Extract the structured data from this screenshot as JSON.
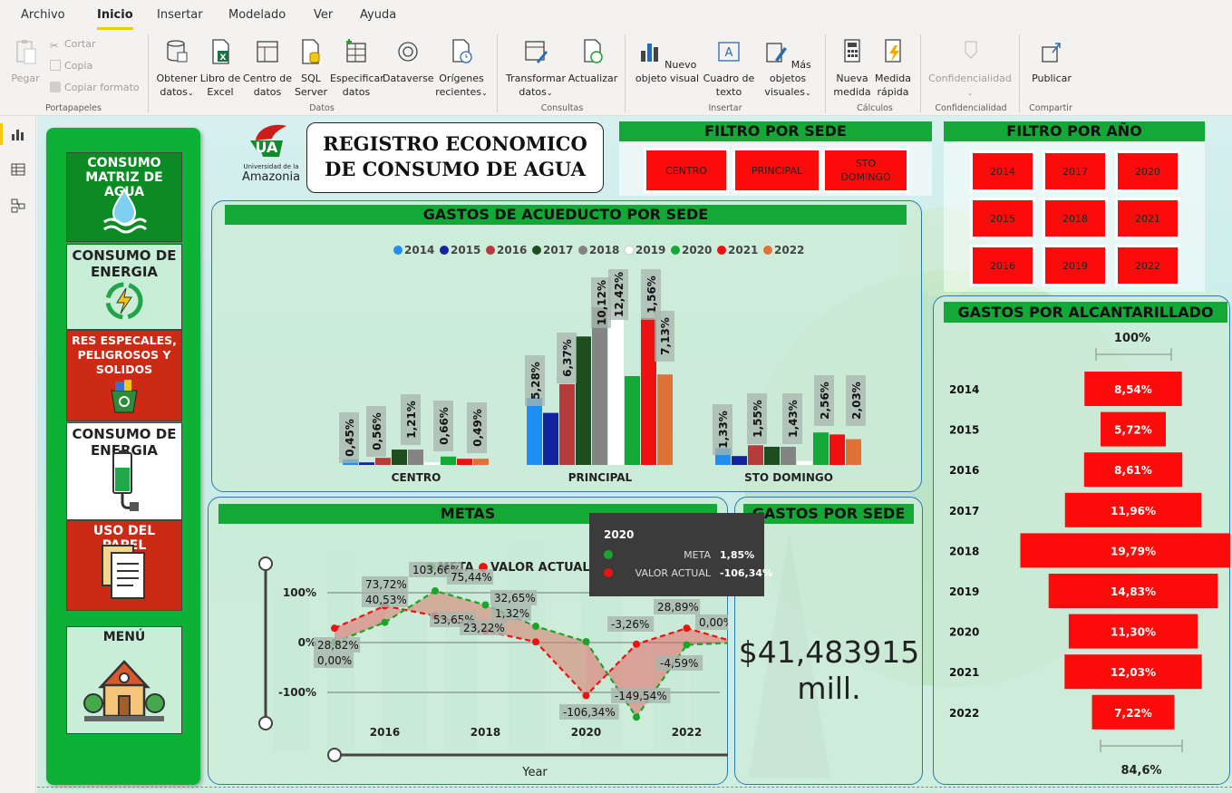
{
  "ribbon": {
    "tabs": [
      "Archivo",
      "Inicio",
      "Insertar",
      "Modelado",
      "Ver",
      "Ayuda"
    ],
    "active_tab": "Inicio",
    "clipboard": {
      "paste": "Pegar",
      "cut": "Cortar",
      "copy": "Copia",
      "format_painter": "Copiar formato",
      "group": "Portapapeles"
    },
    "data": {
      "get_data": "Obtener datos",
      "excel": "Libro de Excel",
      "datahub": "Centro de datos",
      "sql": "SQL Server",
      "enter_data": "Especificar datos",
      "dataverse": "Dataverse",
      "recent": "Orígenes recientes",
      "group": "Datos"
    },
    "queries": {
      "transform": "Transformar datos",
      "refresh": "Actualizar",
      "group": "Consultas"
    },
    "insert": {
      "new_visual": "Nuevo objeto visual",
      "text_box": "Cuadro de texto",
      "more_visuals": "Más objetos visuales",
      "group": "Insertar"
    },
    "calculations": {
      "new_measure": "Nueva medida",
      "quick_measure": "Medida rápida",
      "group": "Cálculos"
    },
    "sensitivity": {
      "label": "Confidencialidad",
      "group": "Confidencialidad"
    },
    "share": {
      "publish": "Publicar",
      "group": "Compartir"
    }
  },
  "report": {
    "logo_text_1": "Universidad de la",
    "logo_text_2": "Amazonia",
    "title_line1": "REGISTRO ECONOMICO",
    "title_line2": "DE CONSUMO DE AGUA",
    "nav": [
      {
        "label": "CONSUMO MATRIZ DE AGUA",
        "bg": "#0c8a24",
        "fg": "#ffffff",
        "icon": "water-icon"
      },
      {
        "label": "CONSUMO DE ENERGIA",
        "bg": "#c9eed8",
        "fg": "#222222",
        "icon": "recycle-energy-icon"
      },
      {
        "label": "RES ESPECALES, PELIGROSOS Y SOLIDOS",
        "bg": "#cc2a14",
        "fg": "#ffffff",
        "icon": "recycle-bin-icon"
      },
      {
        "label": "CONSUMO DE ENERGIA",
        "bg": "#ffffff",
        "fg": "#222222",
        "icon": "battery-plug-icon"
      },
      {
        "label": "USO DEL PAPEL",
        "bg": "#cc2a14",
        "fg": "#ffffff",
        "icon": "documents-icon"
      },
      {
        "label": "MENÚ",
        "bg": "#c9eed8",
        "fg": "#222222",
        "icon": "house-icon"
      }
    ],
    "filtro_sede": {
      "title": "FILTRO POR SEDE",
      "options": [
        "CENTRO",
        "PRINCIPAL",
        "STO DOMINGO"
      ]
    },
    "filtro_ano": {
      "title": "FILTRO POR AÑO",
      "options": [
        "2014",
        "2017",
        "2020",
        "2015",
        "2018",
        "2021",
        "2016",
        "2019",
        "2022"
      ]
    },
    "kpi": {
      "title": "GASTOS POR SEDE",
      "value_line1": "$41,483915",
      "value_line2": "mill."
    },
    "tooltip": {
      "title": "2020",
      "rows": [
        {
          "key": "META",
          "value": "1,85%",
          "color": "#1aa52a"
        },
        {
          "key": "VALOR ACTUAL",
          "value": "-106,34%",
          "color": "#ee1111"
        }
      ]
    }
  },
  "chart_data": [
    {
      "type": "bar",
      "title": "GASTOS DE ACUEDUCTO POR SEDE",
      "categories": [
        "CENTRO",
        "PRINCIPAL",
        "STO DOMINGO"
      ],
      "legend_position": "top-center",
      "series": [
        {
          "name": "2014",
          "color": "#1f8ef1",
          "values": [
            0.45,
            5.28,
            1.33
          ]
        },
        {
          "name": "2015",
          "color": "#12239e",
          "values": [
            0.2,
            4.1,
            0.7
          ]
        },
        {
          "name": "2016",
          "color": "#b83b3b",
          "values": [
            0.56,
            6.37,
            1.55
          ]
        },
        {
          "name": "2017",
          "color": "#1e4d1e",
          "values": [
            1.21,
            10.12,
            1.43
          ]
        },
        {
          "name": "2018",
          "color": "#848484",
          "values": [
            1.21,
            12.42,
            1.43
          ]
        },
        {
          "name": "2019",
          "color": "#ffffff",
          "values": [
            0.2,
            12.4,
            0.3
          ]
        },
        {
          "name": "2020",
          "color": "#14a837",
          "values": [
            0.66,
            7.0,
            2.56
          ]
        },
        {
          "name": "2021",
          "color": "#ee1111",
          "values": [
            0.49,
            11.56,
            2.4
          ]
        },
        {
          "name": "2022",
          "color": "#e07238",
          "values": [
            0.49,
            7.13,
            2.03
          ]
        }
      ],
      "labels": [
        {
          "cat": "CENTRO",
          "texts": [
            "0,45%",
            "0,56%",
            "1,21%",
            "0,66%",
            "0,49%"
          ]
        },
        {
          "cat": "PRINCIPAL",
          "texts": [
            "5,28%",
            "6,37%",
            "10,12%",
            "12,42%",
            "1,56%",
            "7,13%"
          ]
        },
        {
          "cat": "STO DOMINGO",
          "texts": [
            "1,33%",
            "1,55%",
            "1,43%",
            "2,56%",
            "2,03%"
          ]
        }
      ]
    },
    {
      "type": "line",
      "title": "METAS",
      "xlabel": "Year",
      "x": [
        2015,
        2016,
        2017,
        2018,
        2019,
        2020,
        2021,
        2022,
        2023
      ],
      "x_ticks": [
        "2016",
        "2018",
        "2020",
        "2022"
      ],
      "y_ticks": [
        "100%",
        "0%",
        "-100%"
      ],
      "ylim": [
        -150,
        150
      ],
      "series": [
        {
          "name": "META",
          "color": "#1aa52a",
          "values": [
            0.0,
            40.53,
            103.66,
            75.44,
            32.65,
            1.85,
            -149.54,
            -4.59,
            0.0
          ]
        },
        {
          "name": "VALOR ACTUAL",
          "color": "#ee1111",
          "values": [
            28.82,
            73.72,
            53.65,
            23.22,
            1.32,
            -106.34,
            -3.26,
            28.89,
            0.0
          ]
        }
      ],
      "data_labels": [
        "28,82%",
        "0,00%",
        "73,72%",
        "40,53%",
        "103,66%",
        "53,65%",
        "75,44%",
        "23,22%",
        "32,65%",
        "1,32%",
        "-106,34%",
        "-3,26%",
        "-149,54%",
        "28,89%",
        "-4,59%",
        "0,00%"
      ]
    },
    {
      "type": "bar",
      "title": "GASTOS POR ALCANTARILLADO",
      "top_label": "100%",
      "bottom_label": "84,6%",
      "categories": [
        "2014",
        "2015",
        "2016",
        "2017",
        "2018",
        "2019",
        "2020",
        "2021",
        "2022"
      ],
      "values": [
        8.54,
        5.72,
        8.61,
        11.96,
        19.79,
        14.83,
        11.3,
        12.03,
        7.22
      ],
      "value_labels": [
        "8,54%",
        "5,72%",
        "8,61%",
        "11,96%",
        "19,79%",
        "14,83%",
        "11,30%",
        "12,03%",
        "7,22%"
      ]
    }
  ]
}
